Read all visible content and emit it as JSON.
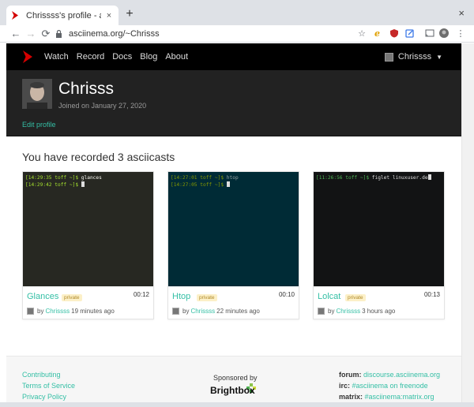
{
  "browser": {
    "tab_title": "Chrissss's profile - asciinema",
    "tab_close": "×",
    "new_tab": "+",
    "window_close": "×",
    "back": "←",
    "forward": "→",
    "reload": "⟳",
    "url": "asciinema.org/~Chrisss",
    "star": "☆"
  },
  "navbar": {
    "links": [
      "Watch",
      "Record",
      "Docs",
      "Blog",
      "About"
    ],
    "user": "Chrissss"
  },
  "profile": {
    "name": "Chrisss",
    "joined": "Joined on January 27, 2020",
    "edit": "Edit profile"
  },
  "section_title": "You have recorded 3 asciicasts",
  "casts": [
    {
      "title": "Glances",
      "badge": "private",
      "duration": "00:12",
      "by": "by",
      "user": "Chrissss",
      "ago": "19 minutes ago",
      "bg": "#272822",
      "lines": [
        {
          "prompt": "[14:29:35 toff ~]$ ",
          "cmd": "glances"
        },
        {
          "prompt": "[14:29:42 toff ~]$ ",
          "cmd": ""
        }
      ]
    },
    {
      "title": "Htop",
      "badge": "private",
      "duration": "00:10",
      "by": "by",
      "user": "Chrissss",
      "ago": "22 minutes ago",
      "bg": "#002b36",
      "lines": [
        {
          "prompt": "[14:27:01 toff ~]$ ",
          "cmd": "htop"
        },
        {
          "prompt": "[14:27:05 toff ~]$ ",
          "cmd": ""
        }
      ]
    },
    {
      "title": "Lolcat",
      "badge": "private",
      "duration": "00:13",
      "by": "by",
      "user": "Chrissss",
      "ago": "3 hours ago",
      "bg": "#121314",
      "lines": [
        {
          "prompt": "[11:26:56 toff ~]$ ",
          "cmd": "figlet linuxuser.de"
        }
      ]
    }
  ],
  "footer": {
    "links": [
      "Contributing",
      "Terms of Service",
      "Privacy Policy"
    ],
    "sponsored": "Sponsored by",
    "sponsor": "Brightbox",
    "forum_label": "forum:",
    "forum": "discourse.asciinema.org",
    "irc_label": "irc:",
    "irc": "#asciinema on freenode",
    "matrix_label": "matrix:",
    "matrix": "#asciinema:matrix.org"
  },
  "colors": {
    "accent": "#34bfa5",
    "logo_red": "#d40000"
  }
}
